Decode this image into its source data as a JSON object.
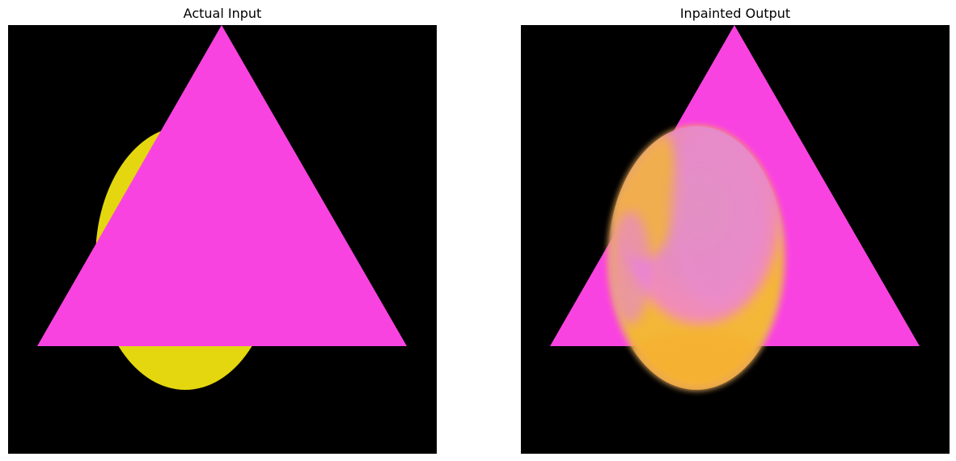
{
  "panels": [
    {
      "title": "Actual Input",
      "image_description_tag": "original-image",
      "colors": {
        "background": "#000000",
        "triangle": "#f943e1",
        "ellipse": "#e4d70f"
      }
    },
    {
      "title": "Inpainted Output",
      "image_description_tag": "inpainted-image",
      "colors": {
        "background": "#000000",
        "triangle": "#f943e1",
        "ellipse_tint": "#f6b231",
        "blend_tint": "#e58ac7"
      }
    }
  ]
}
